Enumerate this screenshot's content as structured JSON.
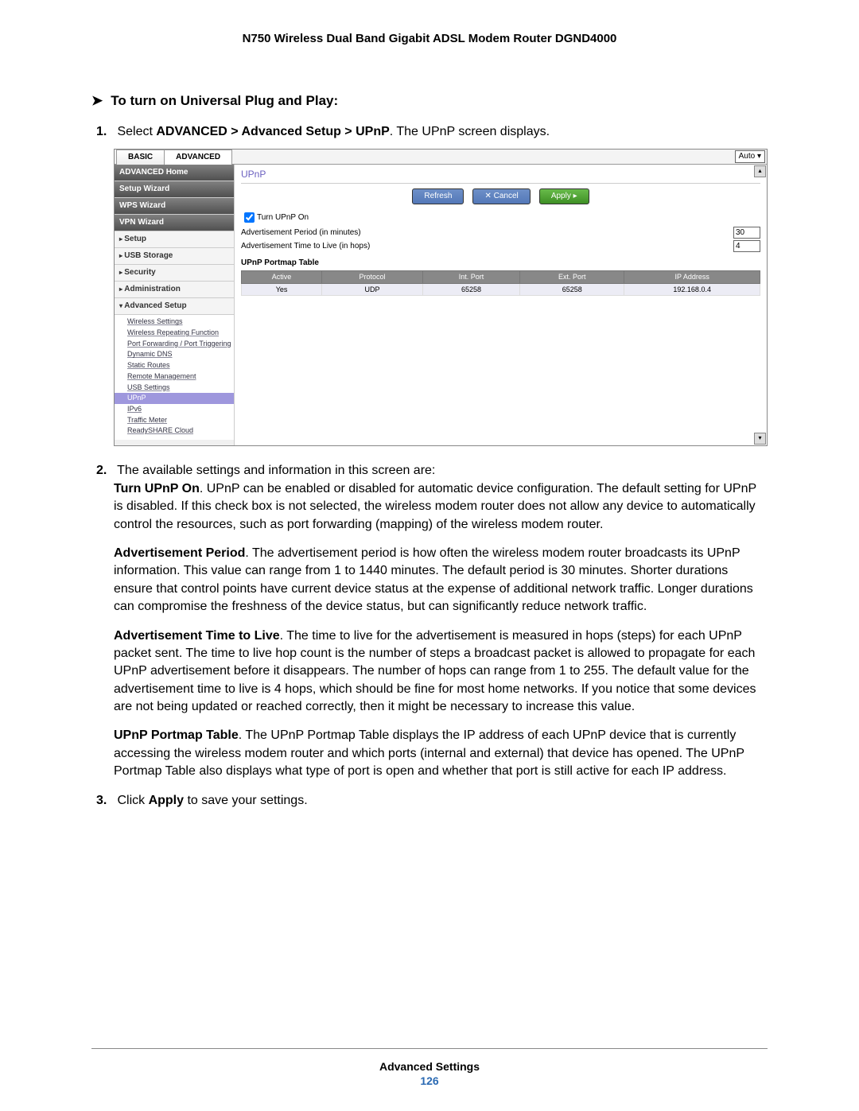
{
  "doc": {
    "title": "N750 Wireless Dual Band Gigabit ADSL Modem Router DGND4000",
    "footer_section": "Advanced Settings",
    "page_number": "126"
  },
  "task": {
    "heading": "To turn on Universal Plug and Play:",
    "step1_prefix": "Select ",
    "step1_path": "ADVANCED > Advanced Setup > UPnP",
    "step1_suffix": ". The UPnP screen displays.",
    "step2_intro": "The available settings and information in this screen are:",
    "turn_upnp_on_label": "Turn UPnP On",
    "turn_upnp_on_text": ". UPnP can be enabled or disabled for automatic device configuration. The default setting for UPnP is disabled. If this check box is not selected, the wireless modem router does not allow any device to automatically control the resources, such as port forwarding (mapping) of the wireless modem router.",
    "adv_period_label": "Advertisement Period",
    "adv_period_text": ". The advertisement period is how often the wireless modem router broadcasts its UPnP information. This value can range from 1 to 1440 minutes. The default period is 30 minutes. Shorter durations ensure that control points have current device status at the expense of additional network traffic. Longer durations can compromise the freshness of the device status, but can significantly reduce network traffic.",
    "adv_ttl_label": "Advertisement Time to Live",
    "adv_ttl_text": ". The time to live for the advertisement is measured in hops (steps) for each UPnP packet sent. The time to live hop count is the number of steps a broadcast packet is allowed to propagate for each UPnP advertisement before it disappears. The number of hops can range from 1 to 255. The default value for the advertisement time to live is 4 hops, which should be fine for most home networks. If you notice that some devices are not being updated or reached correctly, then it might be necessary to increase this value.",
    "portmap_label": "UPnP Portmap Table",
    "portmap_text": ". The UPnP Portmap Table displays the IP address of each UPnP device that is currently accessing the wireless modem router and which ports (internal and external) that device has opened. The UPnP Portmap Table also displays what type of port is open and whether that port is still active for each IP address.",
    "step3_prefix": "Click ",
    "step3_bold": "Apply",
    "step3_suffix": " to save your settings."
  },
  "ui": {
    "tabs": {
      "basic": "BASIC",
      "advanced": "ADVANCED",
      "auto": "Auto"
    },
    "sidebar": {
      "advanced_home": "ADVANCED Home",
      "setup_wizard": "Setup Wizard",
      "wps_wizard": "WPS Wizard",
      "vpn_wizard": "VPN Wizard",
      "setup": "Setup",
      "usb_storage": "USB Storage",
      "security": "Security",
      "administration": "Administration",
      "advanced_setup": "Advanced Setup",
      "subs": {
        "wireless_settings": "Wireless Settings",
        "wireless_repeating": "Wireless Repeating Function",
        "port_fwd": "Port Forwarding / Port Triggering",
        "ddns": "Dynamic DNS",
        "static_routes": "Static Routes",
        "remote_mgmt": "Remote Management",
        "usb_settings": "USB Settings",
        "upnp": "UPnP",
        "ipv6": "IPv6",
        "traffic_meter": "Traffic Meter",
        "readyshare": "ReadySHARE Cloud"
      }
    },
    "content": {
      "title": "UPnP",
      "buttons": {
        "refresh": "Refresh",
        "cancel": "Cancel",
        "apply": "Apply"
      },
      "turn_on_label": "Turn UPnP On",
      "adv_period_label": "Advertisement Period (in minutes)",
      "adv_period_value": "30",
      "adv_ttl_label": "Advertisement Time to Live (in hops)",
      "adv_ttl_value": "4",
      "portmap_title": "UPnP Portmap Table",
      "headers": {
        "active": "Active",
        "protocol": "Protocol",
        "int_port": "Int. Port",
        "ext_port": "Ext. Port",
        "ip": "IP Address"
      },
      "row": {
        "active": "Yes",
        "protocol": "UDP",
        "int_port": "65258",
        "ext_port": "65258",
        "ip": "192.168.0.4"
      }
    }
  }
}
